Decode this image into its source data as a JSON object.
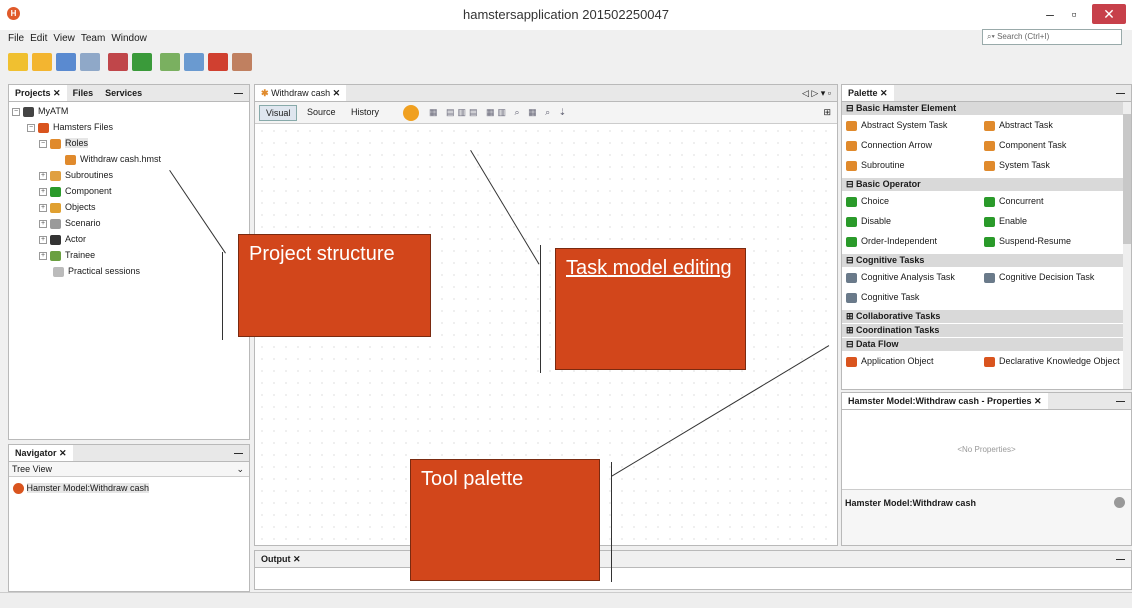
{
  "window": {
    "title": "hamstersapplication 201502250047"
  },
  "menu": [
    "File",
    "Edit",
    "View",
    "Team",
    "Window"
  ],
  "search": {
    "placeholder": "Search (Ctrl+I)"
  },
  "projects_panel": {
    "tabs": [
      "Projects",
      "Files",
      "Services"
    ],
    "tree": [
      {
        "label": "MyATM",
        "icon": "project-icon",
        "color": "#444444"
      },
      {
        "label": "Hamsters Files",
        "icon": "hamster-icon",
        "color": "#d9541e"
      },
      {
        "label": "Roles",
        "icon": "role-icon",
        "color": "#e08a2c"
      },
      {
        "label": "Withdraw cash.hmst",
        "icon": "task-file-icon",
        "color": "#e08a2c"
      },
      {
        "label": "Subroutines",
        "icon": "subroutine-icon",
        "color": "#e0a040"
      },
      {
        "label": "Component",
        "icon": "component-icon",
        "color": "#2a9a2a"
      },
      {
        "label": "Objects",
        "icon": "objects-icon",
        "color": "#e0a030"
      },
      {
        "label": "Scenario",
        "icon": "scenario-icon",
        "color": "#9a9a9a"
      },
      {
        "label": "Actor",
        "icon": "actor-icon",
        "color": "#333333"
      },
      {
        "label": "Trainee",
        "icon": "trainee-icon",
        "color": "#6aa040"
      },
      {
        "label": "Practical sessions",
        "icon": "sessions-icon",
        "color": "#bbbbbb"
      }
    ]
  },
  "navigator": {
    "tab": "Navigator",
    "view": "Tree View",
    "item": "Hamster Model:Withdraw cash"
  },
  "editor": {
    "tab": "Withdraw cash",
    "modes": [
      "Visual",
      "Source",
      "History"
    ]
  },
  "output": {
    "tab": "Output"
  },
  "palette": {
    "tab": "Palette",
    "groups": [
      {
        "name": "Basic Hamster Element",
        "items": [
          "Abstract System Task",
          "Abstract Task",
          "Connection Arrow",
          "Component Task",
          "Subroutine",
          "System Task"
        ]
      },
      {
        "name": "Basic Operator",
        "items": [
          "Choice",
          "Concurrent",
          "Disable",
          "Enable",
          "Order-Independent",
          "Suspend-Resume"
        ]
      },
      {
        "name": "Cognitive Tasks",
        "items": [
          "Cognitive Analysis Task",
          "Cognitive Decision Task",
          "Cognitive Task"
        ]
      },
      {
        "name": "Collaborative Tasks",
        "items": []
      },
      {
        "name": "Coordination Tasks",
        "items": []
      },
      {
        "name": "Data Flow",
        "items": [
          "Application Object",
          "Declarative Knowledge Object"
        ]
      }
    ]
  },
  "properties": {
    "tab": "Hamster Model:Withdraw cash - Properties",
    "empty": "<No Properties>",
    "footer": "Hamster Model:Withdraw cash"
  },
  "callouts": {
    "project_structure": "Project structure",
    "task_model_word": "Task",
    "task_model_rest": " model editing",
    "tool_palette": "Tool palette"
  }
}
